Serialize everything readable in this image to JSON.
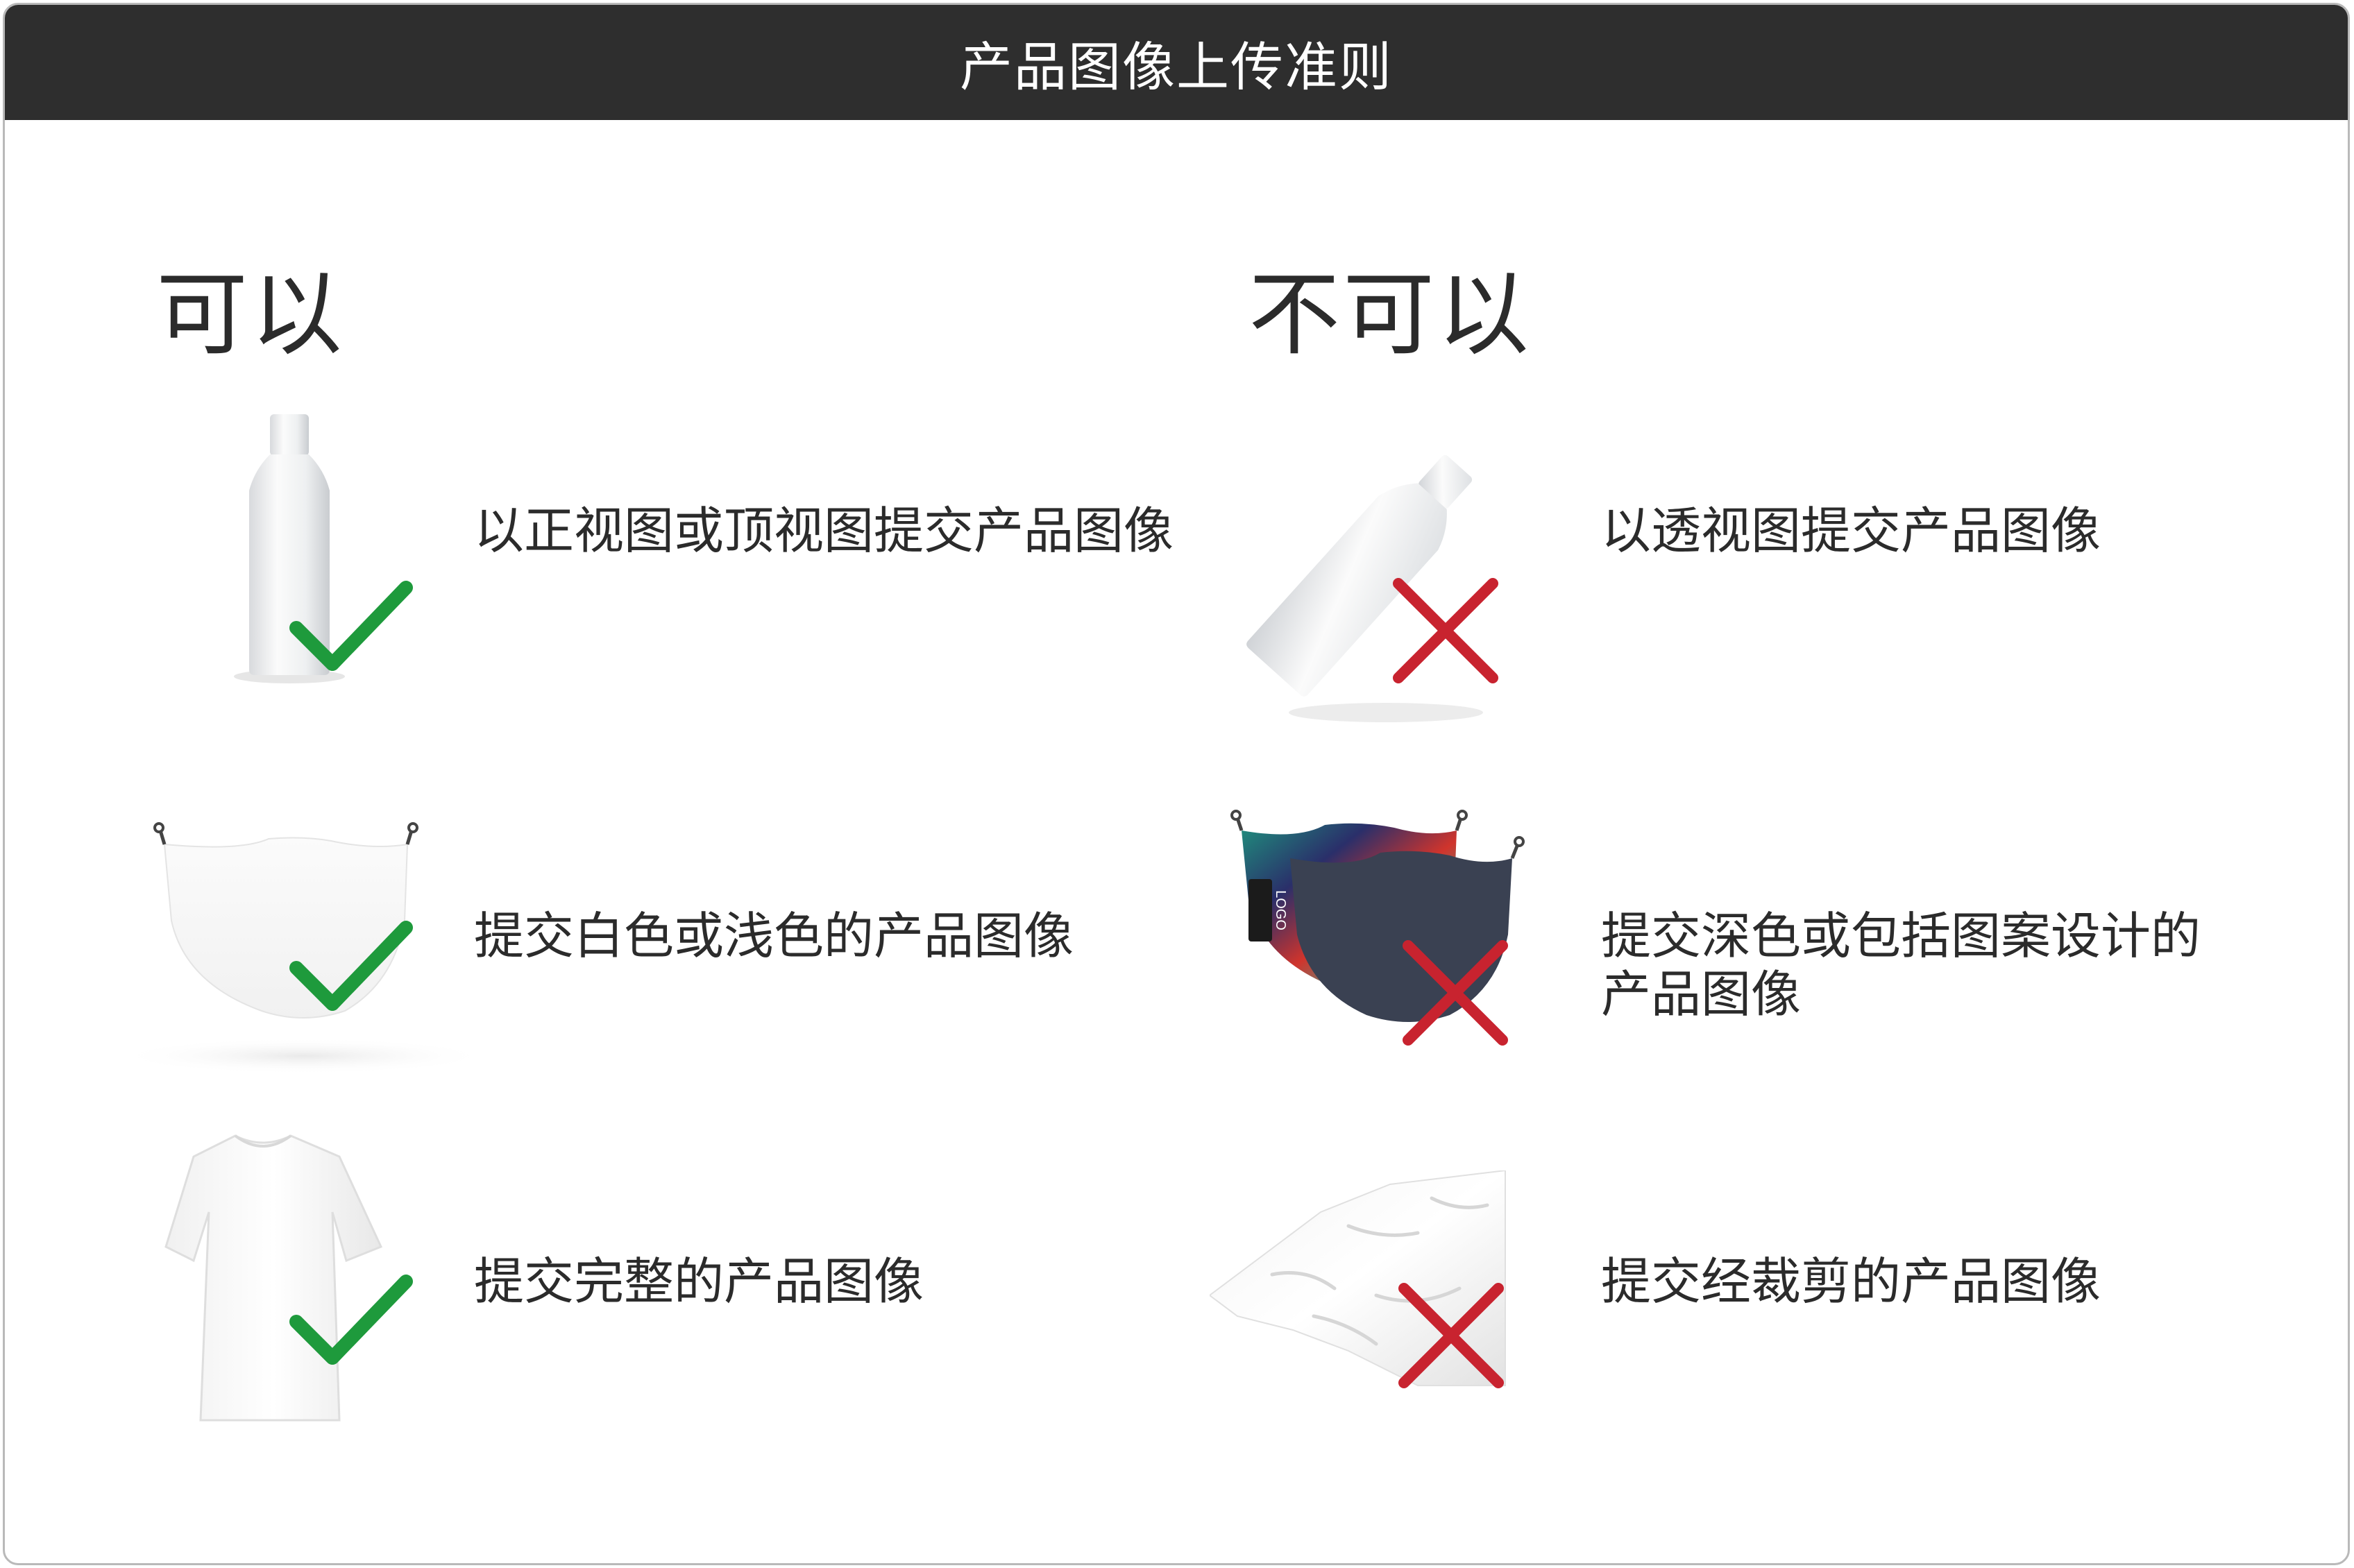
{
  "header": {
    "title": "产品图像上传准则"
  },
  "columns": {
    "do": {
      "title": "可以"
    },
    "dont": {
      "title": "不可以"
    }
  },
  "do_items": [
    {
      "icon": "bottle-upright-image",
      "mark": "check-icon",
      "caption": "以正视图或顶视图提交产品图像"
    },
    {
      "icon": "white-mask-image",
      "mark": "check-icon",
      "caption": "提交白色或浅色的产品图像"
    },
    {
      "icon": "white-tshirt-image",
      "mark": "check-icon",
      "caption": "提交完整的产品图像"
    }
  ],
  "dont_items": [
    {
      "icon": "bottle-tilted-image",
      "mark": "cross-icon",
      "caption": "以透视图提交产品图像"
    },
    {
      "icon": "dark-patterned-mask-image",
      "mark": "cross-icon",
      "caption_line1": "提交深色或包括图案设计的",
      "caption_line2": "产品图像",
      "logo_text": "LOGO"
    },
    {
      "icon": "cropped-tshirt-image",
      "mark": "cross-icon",
      "caption": "提交经裁剪的产品图像"
    }
  ],
  "colors": {
    "header_bg": "#2e2e2e",
    "check": "#1e9a3c",
    "cross": "#c8232f",
    "mask_dark": "#3a4152"
  }
}
